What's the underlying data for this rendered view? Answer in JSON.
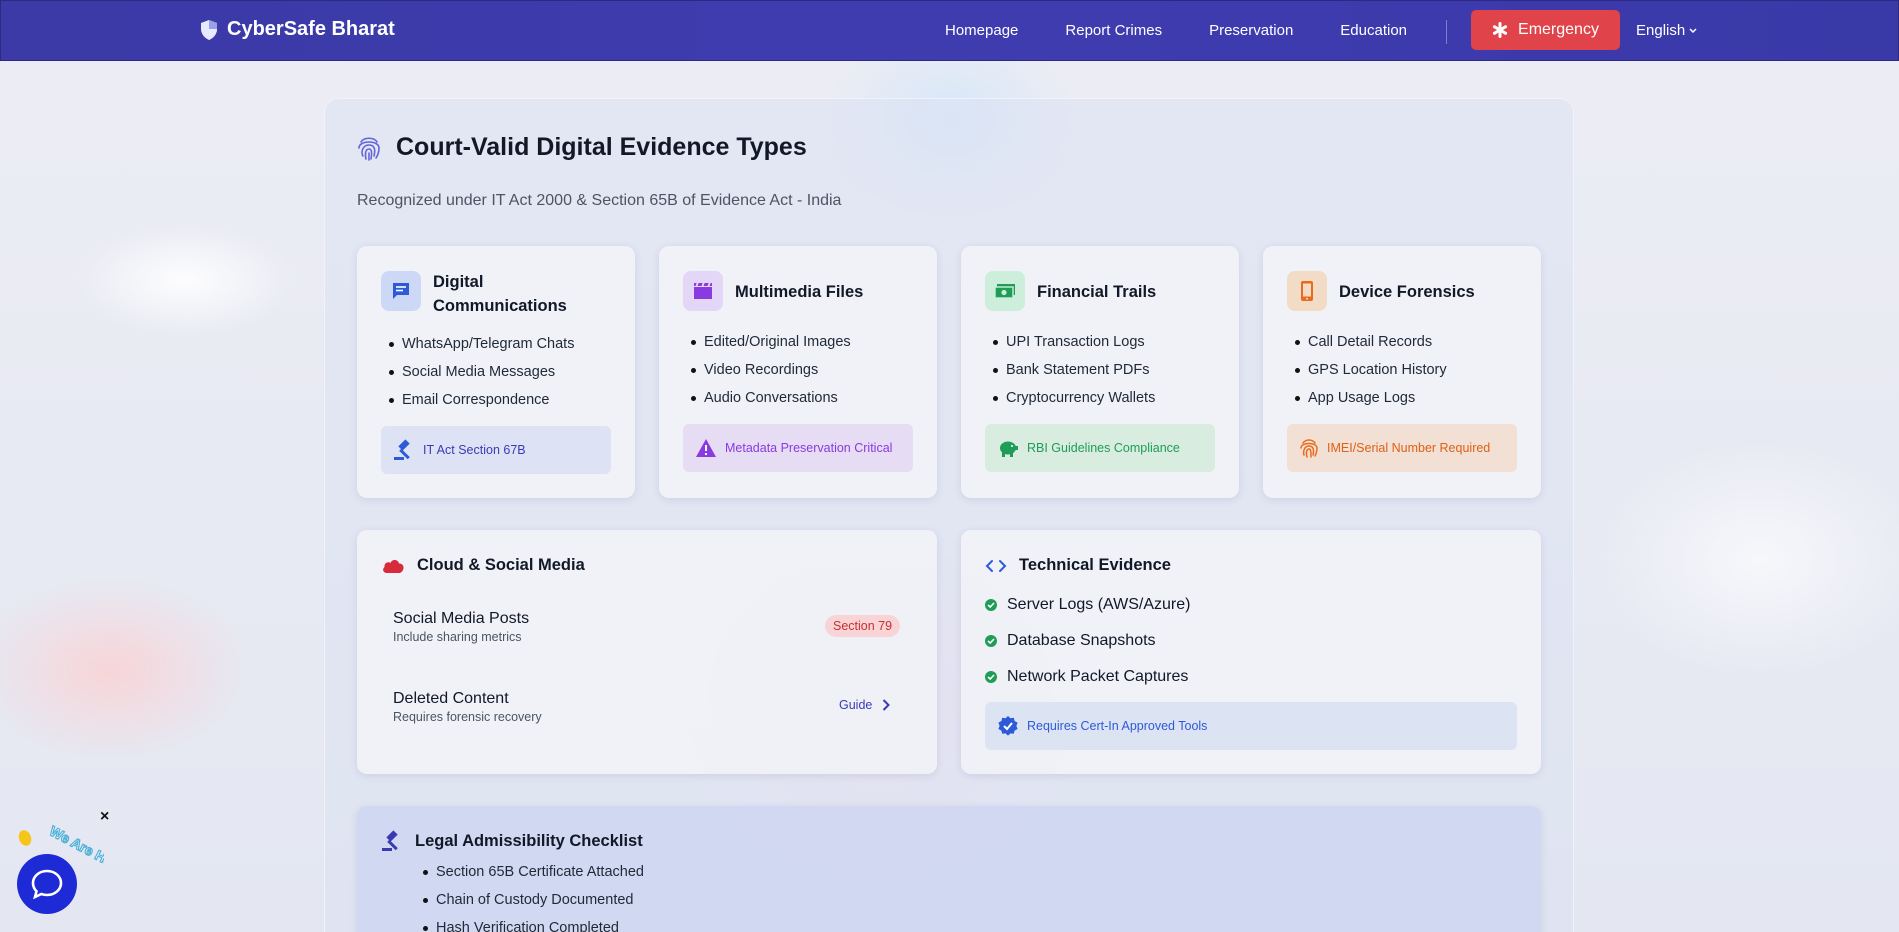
{
  "nav": {
    "brand": "CyberSafe Bharat",
    "links": [
      "Homepage",
      "Report Crimes",
      "Preservation",
      "Education"
    ],
    "emergency": "Emergency",
    "language": "English"
  },
  "main": {
    "title": "Court-Valid Digital Evidence Types",
    "subtitle": "Recognized under IT Act 2000 & Section 65B of Evidence Act - India",
    "cards": [
      {
        "title": "Digital Communications",
        "items": [
          "WhatsApp/Telegram Chats",
          "Social Media Messages",
          "Email Correspondence"
        ],
        "footer": "IT Act Section 67B",
        "icon": "message-icon"
      },
      {
        "title": "Multimedia Files",
        "items": [
          "Edited/Original Images",
          "Video Recordings",
          "Audio Conversations"
        ],
        "footer": "Metadata Preservation Critical",
        "icon": "film-icon"
      },
      {
        "title": "Financial Trails",
        "items": [
          "UPI Transaction Logs",
          "Bank Statement PDFs",
          "Cryptocurrency Wallets"
        ],
        "footer": "RBI Guidelines Compliance",
        "icon": "money-icon"
      },
      {
        "title": "Device Forensics",
        "items": [
          "Call Detail Records",
          "GPS Location History",
          "App Usage Logs"
        ],
        "footer": "IMEI/Serial Number Required",
        "icon": "mobile-icon"
      }
    ],
    "cloud": {
      "title": "Cloud & Social Media",
      "rows": [
        {
          "title": "Social Media Posts",
          "sub": "Include sharing metrics",
          "badge": "Section 79"
        },
        {
          "title": "Deleted Content",
          "sub": "Requires forensic recovery",
          "link": "Guide"
        }
      ]
    },
    "technical": {
      "title": "Technical Evidence",
      "items": [
        "Server Logs (AWS/Azure)",
        "Database Snapshots",
        "Network Packet Captures"
      ],
      "footer": "Requires Cert-In Approved Tools"
    },
    "checklist": {
      "title": "Legal Admissibility Checklist",
      "items": [
        "Section 65B Certificate Attached",
        "Chain of Custody Documented",
        "Hash Verification Completed"
      ]
    }
  },
  "widget": {
    "close": "×",
    "badge_text": "We Are Here!"
  },
  "colors": {
    "nav": "#3b3aa6",
    "emergency": "#e0434a",
    "accent": "#3b3ab5"
  }
}
